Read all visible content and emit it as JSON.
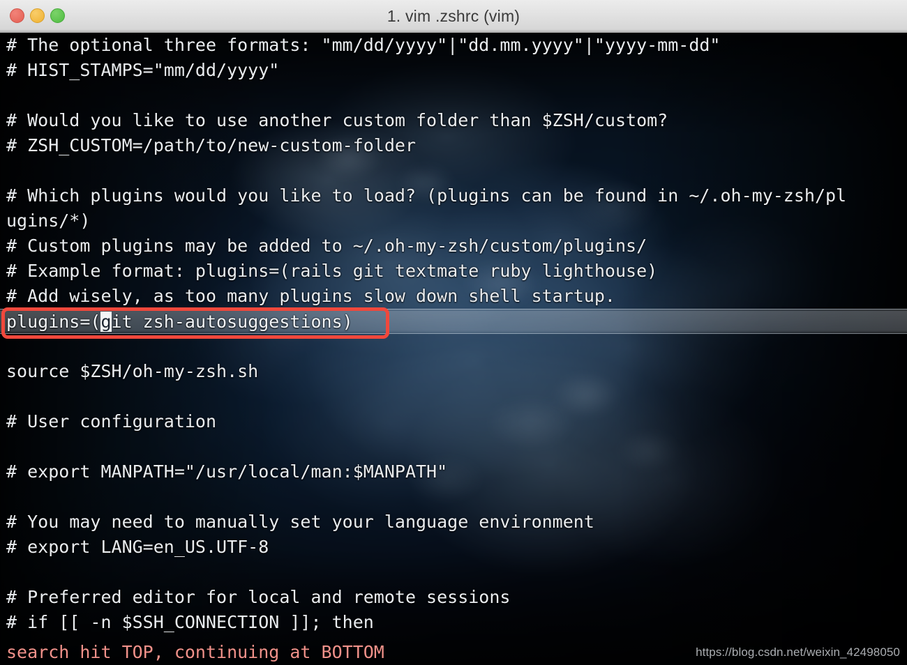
{
  "window": {
    "title": "1. vim .zshrc (vim)",
    "controls": [
      {
        "name": "close",
        "color": "#e35f53"
      },
      {
        "name": "minimize",
        "color": "#efb131"
      },
      {
        "name": "maximize",
        "color": "#4fbd41"
      }
    ]
  },
  "editor": {
    "lines": [
      {
        "text": "# The optional three formats: \"mm/dd/yyyy\"|\"dd.mm.yyyy\"|\"yyyy-mm-dd\"",
        "style": "comment"
      },
      {
        "text": "# HIST_STAMPS=\"mm/dd/yyyy\"",
        "style": "comment"
      },
      {
        "text": "",
        "style": "empty"
      },
      {
        "text": "# Would you like to use another custom folder than $ZSH/custom?",
        "style": "comment"
      },
      {
        "text": "# ZSH_CUSTOM=/path/to/new-custom-folder",
        "style": "comment"
      },
      {
        "text": "",
        "style": "empty"
      },
      {
        "text": "# Which plugins would you like to load? (plugins can be found in ~/.oh-my-zsh/pl",
        "style": "comment"
      },
      {
        "text": "ugins/*)",
        "style": "comment-wrap"
      },
      {
        "text": "# Custom plugins may be added to ~/.oh-my-zsh/custom/plugins/",
        "style": "comment"
      },
      {
        "text": "# Example format: plugins=(rails git textmate ruby lighthouse)",
        "style": "comment"
      },
      {
        "text": "# Add wisely, as too many plugins slow down shell startup.",
        "style": "comment"
      },
      {
        "text": "",
        "style": "highlight"
      },
      {
        "text": "",
        "style": "empty"
      },
      {
        "text": "source $ZSH/oh-my-zsh.sh",
        "style": "code"
      },
      {
        "text": "",
        "style": "empty"
      },
      {
        "text": "# User configuration",
        "style": "comment"
      },
      {
        "text": "",
        "style": "empty"
      },
      {
        "text": "# export MANPATH=\"/usr/local/man:$MANPATH\"",
        "style": "comment"
      },
      {
        "text": "",
        "style": "empty"
      },
      {
        "text": "# You may need to manually set your language environment",
        "style": "comment"
      },
      {
        "text": "# export LANG=en_US.UTF-8",
        "style": "comment"
      },
      {
        "text": "",
        "style": "empty"
      },
      {
        "text": "# Preferred editor for local and remote sessions",
        "style": "comment"
      },
      {
        "text": "# if [[ -n $SSH_CONNECTION ]]; then",
        "style": "comment"
      }
    ],
    "highlighted_line": {
      "prefix": "plugins=(",
      "cursor_char": "g",
      "suffix": "it zsh-autosuggestions)"
    },
    "status_message": "search hit TOP, continuing at BOTTOM"
  },
  "annotation": {
    "type": "red-rectangle",
    "color": "#f0483c"
  },
  "watermark": {
    "text": "https://blog.csdn.net/weixin_42498050"
  }
}
